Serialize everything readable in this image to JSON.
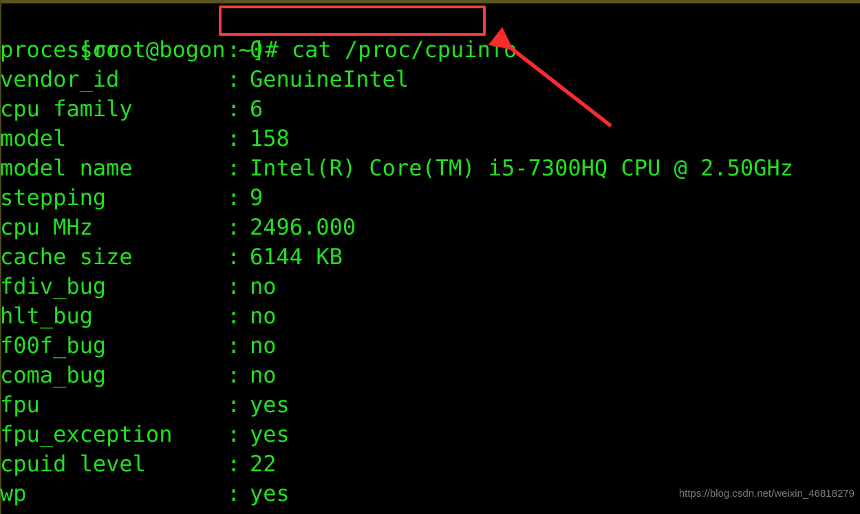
{
  "terminal": {
    "background_color": "#000000",
    "text_color": "#22e022",
    "top_bar_color": "#5c5520",
    "annotation_color": "#fb3a3a",
    "prompt": "[root@bogon ~]# ",
    "command": "cat /proc/cpuinfo",
    "colon": ":",
    "lines": [
      {
        "key": "processor",
        "value": "0"
      },
      {
        "key": "vendor_id",
        "value": "GenuineIntel"
      },
      {
        "key": "cpu family",
        "value": "6"
      },
      {
        "key": "model",
        "value": "158"
      },
      {
        "key": "model name",
        "value": "Intel(R) Core(TM) i5-7300HQ CPU @ 2.50GHz"
      },
      {
        "key": "stepping",
        "value": "9"
      },
      {
        "key": "cpu MHz",
        "value": "2496.000"
      },
      {
        "key": "cache size",
        "value": "6144 KB"
      },
      {
        "key": "fdiv_bug",
        "value": "no"
      },
      {
        "key": "hlt_bug",
        "value": "no"
      },
      {
        "key": "f00f_bug",
        "value": "no"
      },
      {
        "key": "coma_bug",
        "value": "no"
      },
      {
        "key": "fpu",
        "value": "yes"
      },
      {
        "key": "fpu_exception",
        "value": "yes"
      },
      {
        "key": "cpuid level",
        "value": "22"
      },
      {
        "key": "wp",
        "value": "yes"
      }
    ]
  },
  "annotations": {
    "command_box_label": "cat /proc/cpuinfo",
    "arrow_label": "points-to-command"
  },
  "watermark": {
    "text": "https://blog.csdn.net/weixin_46818279"
  }
}
